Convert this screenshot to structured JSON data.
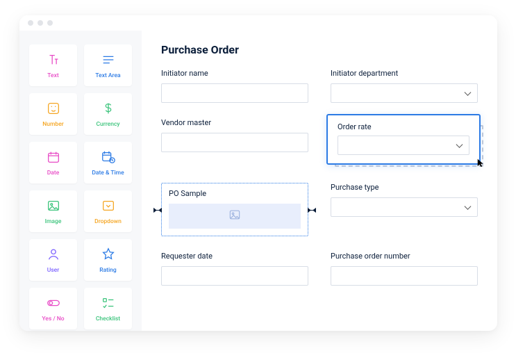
{
  "palette": [
    {
      "id": "text",
      "label": "Text",
      "color": "c-pink"
    },
    {
      "id": "textarea",
      "label": "Text Area",
      "color": "c-blue"
    },
    {
      "id": "number",
      "label": "Number",
      "color": "c-orange"
    },
    {
      "id": "currency",
      "label": "Currency",
      "color": "c-green"
    },
    {
      "id": "date",
      "label": "Date",
      "color": "c-pink"
    },
    {
      "id": "datetime",
      "label": "Date & Time",
      "color": "c-blue"
    },
    {
      "id": "image",
      "label": "Image",
      "color": "c-green"
    },
    {
      "id": "dropdown",
      "label": "Dropdown",
      "color": "c-orange"
    },
    {
      "id": "user",
      "label": "User",
      "color": "c-violet"
    },
    {
      "id": "rating",
      "label": "Rating",
      "color": "c-blue"
    },
    {
      "id": "yesno",
      "label": "Yes / No",
      "color": "c-pink"
    },
    {
      "id": "checklist",
      "label": "Checklist",
      "color": "c-green"
    }
  ],
  "form": {
    "title": "Purchase Order",
    "fields": {
      "initiator_name": {
        "label": "Initiator name",
        "type": "input"
      },
      "initiator_department": {
        "label": "Initiator department",
        "type": "select"
      },
      "vendor_master": {
        "label": "Vendor master",
        "type": "input"
      },
      "order_rate": {
        "label": "Order rate",
        "type": "select",
        "dragging": true
      },
      "po_sample": {
        "label": "PO Sample",
        "type": "dropzone"
      },
      "purchase_type": {
        "label": "Purchase type",
        "type": "select"
      },
      "requester_date": {
        "label": "Requester date",
        "type": "input"
      },
      "purchase_order_number": {
        "label": "Purchase order number",
        "type": "input"
      }
    }
  }
}
